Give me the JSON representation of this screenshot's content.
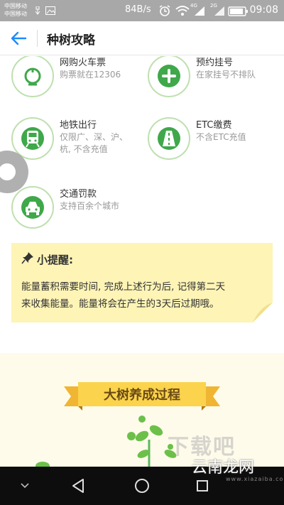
{
  "statusbar": {
    "carrier_1": "中国移动",
    "carrier_2": "中国移动",
    "speed": "84B/s",
    "net_1": "4G",
    "net_2": "2G",
    "time": "09:08",
    "icons": [
      "usb-icon",
      "image-icon",
      "alarm-icon",
      "wifi-icon",
      "signal-icon",
      "battery-icon"
    ]
  },
  "header": {
    "title": "种树攻略",
    "back_icon": "arrow-left-icon",
    "accent": "#1a8cff"
  },
  "services": [
    {
      "title": "网购火车票",
      "desc": [
        "购票就在12306"
      ],
      "icon": "train-logo-icon"
    },
    {
      "title": "预约挂号",
      "desc": [
        "在家挂号不排队"
      ],
      "icon": "medical-plus-icon"
    },
    {
      "title": "地铁出行",
      "desc": [
        "仅限广、深、沪、",
        "杭, 不含充值"
      ],
      "icon": "subway-icon"
    },
    {
      "title": "ETC缴费",
      "desc": [
        "不含ETC充值"
      ],
      "icon": "highway-icon"
    },
    {
      "title": "交通罚款",
      "desc": [
        "支持百余个城市"
      ],
      "icon": "car-icon"
    }
  ],
  "note": {
    "title": "小提醒:",
    "lines": [
      "能量蓄积需要时间, 完成上述行为后, 记得第二天",
      "来收集能量。能量将会在产生的3天后过期哦。"
    ],
    "pin_icon": "pushpin-icon",
    "background": "#fdf4b6"
  },
  "banner": {
    "title": "大树养成过程"
  },
  "colors": {
    "green": "#3fa84a",
    "green_ring": "#bfe0b0",
    "bottom_bg": "#fefbea"
  },
  "watermark": {
    "big": "下载吧",
    "site": "云南龙网",
    "url": "www.xiazaiba.com"
  },
  "navbar": {
    "icons": [
      "chevron-down-icon",
      "back-triangle-icon",
      "home-circle-icon",
      "recents-square-icon"
    ]
  }
}
